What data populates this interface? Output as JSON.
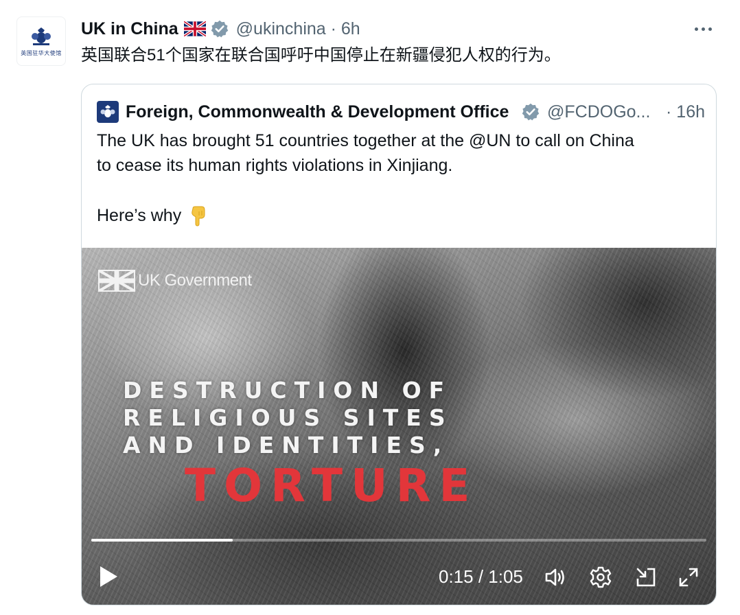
{
  "tweet": {
    "author_name": "UK in China",
    "handle_time": "@ukinchina · 6h",
    "avatar_caption": "英国驻华大使馆",
    "text": "英国联合51个国家在联合国呼吁中国停止在新疆侵犯人权的行为。"
  },
  "quote": {
    "author_name": "Foreign, Commonwealth & Development Office",
    "handle": "@FCDOGo...",
    "time": "· 16h",
    "text_lines": [
      "The UK has brought 51 countries together at the @UN to call on China",
      "to cease its human rights violations in Xinjiang."
    ],
    "why": "Here’s why"
  },
  "video": {
    "logo_text": "UK Government",
    "caption_lines": [
      "DESTRUCTION OF",
      "RELIGIOUS SITES",
      "AND IDENTITIES,"
    ],
    "highlight": "TORTURE",
    "time_display": "0:15 / 1:05",
    "progress_fraction": 0.23
  },
  "colors": {
    "verified": "#829aab",
    "accent_red": "#e2363a",
    "muted": "#536471"
  }
}
